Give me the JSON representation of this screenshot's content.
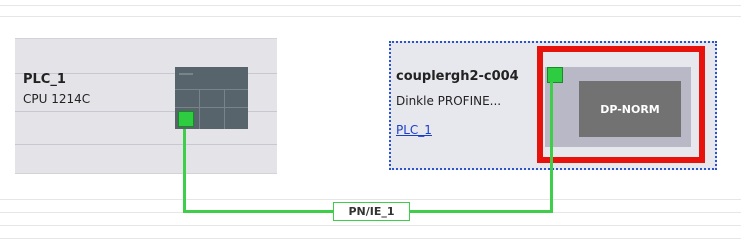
{
  "devices": {
    "plc": {
      "name": "PLC_1",
      "type": "CPU 1214C"
    },
    "coupler": {
      "name": "couplergh2-c004",
      "type": "Dinkle PROFINE...",
      "link": "PLC_1",
      "module_label": "DP-NORM"
    }
  },
  "network": {
    "label": "PN/IE_1"
  },
  "colors": {
    "network_line": "#3fce4a",
    "selection_border": "#2a54c8",
    "highlight": "#e8120c",
    "port": "#2ecc40"
  }
}
